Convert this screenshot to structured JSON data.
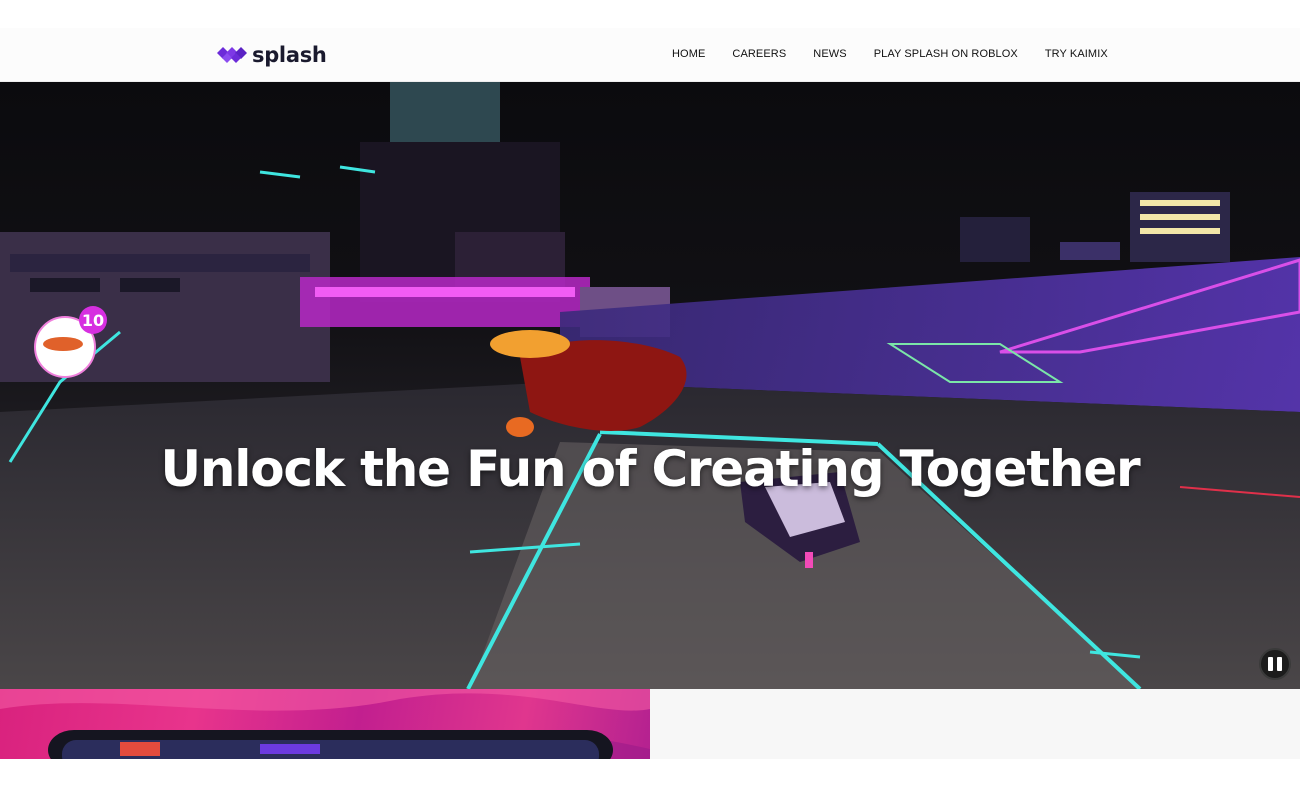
{
  "brand": {
    "name": "splash",
    "accent": "#6c2bd9"
  },
  "nav": {
    "items": [
      {
        "label": "HOME"
      },
      {
        "label": "CAREERS"
      },
      {
        "label": "NEWS"
      },
      {
        "label": "PLAY SPLASH ON ROBLOX"
      },
      {
        "label": "TRY KAIMIX"
      }
    ]
  },
  "hero": {
    "headline": "Unlock the Fun of Creating Together",
    "badge_count": "10",
    "pause_icon": "pause-icon"
  },
  "colors": {
    "neon_cyan": "#3fe6e0",
    "neon_magenta": "#d62fe0",
    "neon_purple": "#7a3df0",
    "promo_pink": "#e0348c"
  }
}
